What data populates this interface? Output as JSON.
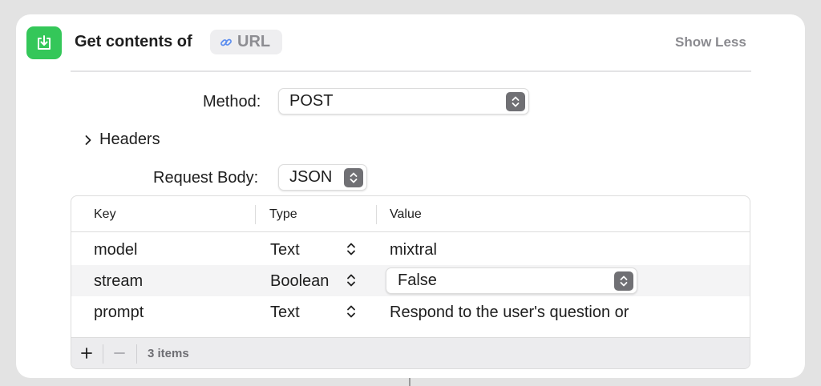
{
  "action": {
    "title": "Get contents of",
    "url_token": "URL",
    "show_less": "Show Less",
    "icon": "download-tray-icon",
    "accent": "#34c759"
  },
  "method": {
    "label": "Method:",
    "value": "POST"
  },
  "headers": {
    "label": "Headers",
    "icon": "chevron-right-icon"
  },
  "request_body": {
    "label": "Request Body:",
    "value": "JSON"
  },
  "table": {
    "columns": [
      "Key",
      "Type",
      "Value"
    ],
    "rows": [
      {
        "key": "model",
        "type": "Text",
        "value": "mixtral"
      },
      {
        "key": "stream",
        "type": "Boolean",
        "value": "False"
      },
      {
        "key": "prompt",
        "type": "Text",
        "value": "Respond to the user's question or"
      }
    ],
    "footer": {
      "add": "+",
      "remove": "−",
      "count": "3 items"
    }
  }
}
